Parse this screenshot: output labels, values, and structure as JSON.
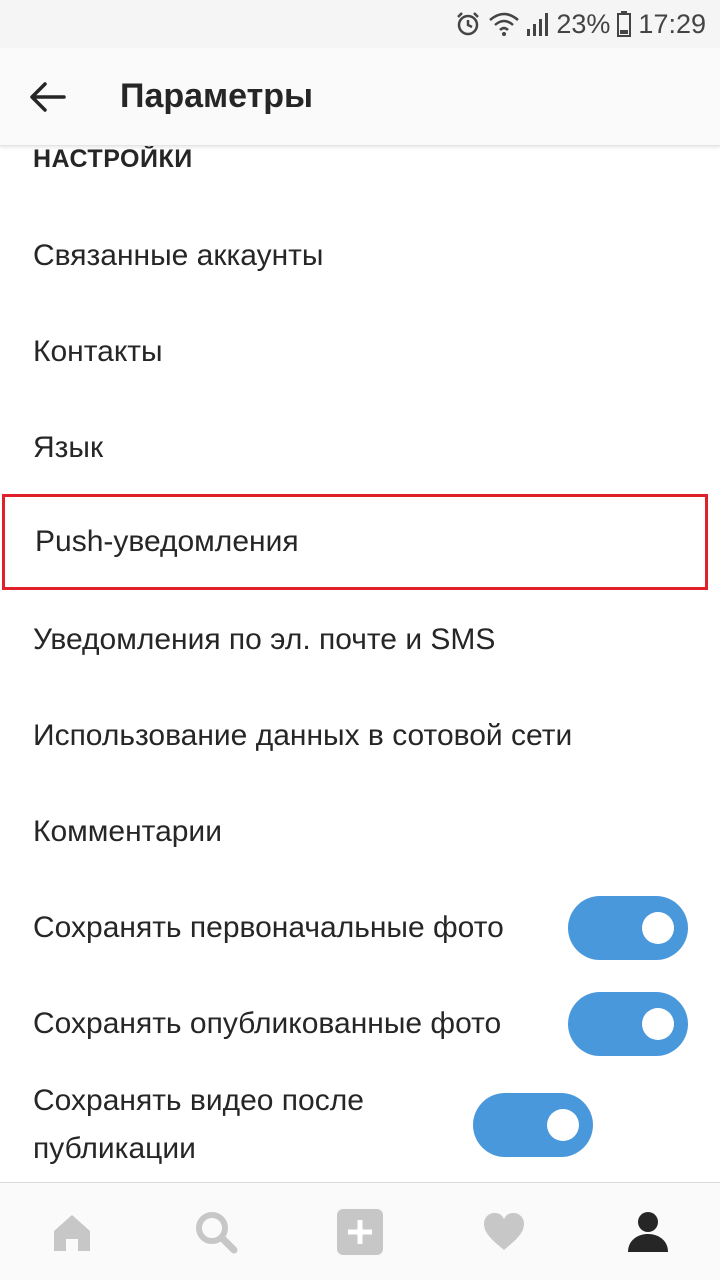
{
  "status_bar": {
    "battery": "23%",
    "time": "17:29",
    "icons": [
      "alarm-icon",
      "wifi-icon",
      "signal-icon",
      "battery-icon"
    ]
  },
  "app_bar": {
    "title": "Параметры",
    "back_icon": "arrow-left-icon"
  },
  "settings": {
    "section_title": "НАСТРОЙКИ",
    "items": [
      {
        "label": "Связанные аккаунты"
      },
      {
        "label": "Контакты"
      },
      {
        "label": "Язык"
      },
      {
        "label": "Push-уведомления",
        "highlighted": true
      },
      {
        "label": "Уведомления по эл. почте и SMS"
      },
      {
        "label": "Использование данных в сотовой сети"
      },
      {
        "label": "Комментарии"
      }
    ],
    "toggles": [
      {
        "label": "Сохранять первоначальные фото",
        "on": true
      },
      {
        "label": "Сохранять опубликованные фото",
        "on": true
      },
      {
        "label": "Сохранять видео после публикации",
        "on": true
      }
    ]
  },
  "bottom_nav": {
    "items": [
      "home-icon",
      "search-icon",
      "add-icon",
      "heart-icon",
      "profile-icon"
    ],
    "active": "profile-icon"
  },
  "colors": {
    "toggle_on": "#4a98dc",
    "highlight_border": "#e0202a",
    "inactive_icon": "#c7c7c7",
    "active_icon": "#262626"
  }
}
